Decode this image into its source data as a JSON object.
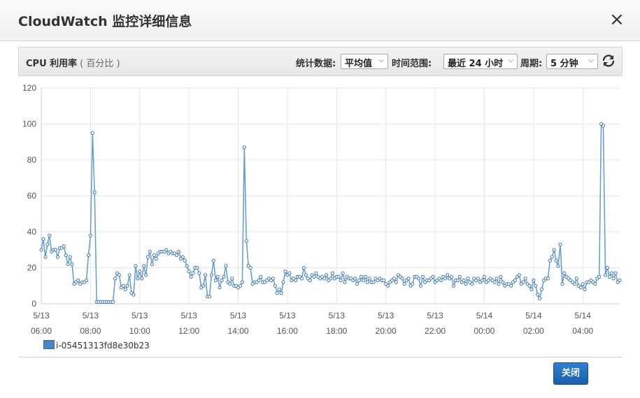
{
  "dialog": {
    "title": "CloudWatch 监控详细信息",
    "close_glyph": "×",
    "close_button": "关闭"
  },
  "toolbar": {
    "metric_name": "CPU 利用率",
    "metric_unit": "( 百分比 )",
    "stat_label": "统计数据:",
    "stat_value": "平均值",
    "range_label": "时间范围:",
    "range_value": "最近 24 小时",
    "period_label": "周期:",
    "period_value": "5 分钟",
    "refresh_icon": "refresh-icon"
  },
  "legend": {
    "label": "i-05451313fd8e30b23"
  },
  "colors": {
    "series": "#6a9fd4",
    "series_marker": "#3a78b8",
    "grid": "#e6e6e6"
  },
  "chart_data": {
    "type": "line",
    "title": "",
    "xlabel": "",
    "ylabel": "",
    "ylim": [
      0,
      120
    ],
    "yticks": [
      0,
      20,
      40,
      60,
      80,
      100,
      120
    ],
    "xtick_labels": [
      [
        "5/13",
        "06:00"
      ],
      [
        "5/13",
        "08:00"
      ],
      [
        "5/13",
        "10:00"
      ],
      [
        "5/13",
        "12:00"
      ],
      [
        "5/13",
        "14:00"
      ],
      [
        "5/13",
        "16:00"
      ],
      [
        "5/13",
        "18:00"
      ],
      [
        "5/13",
        "20:00"
      ],
      [
        "5/13",
        "22:00"
      ],
      [
        "5/14",
        "00:00"
      ],
      [
        "5/14",
        "02:00"
      ],
      [
        "5/14",
        "04:00"
      ]
    ],
    "xtick_hours": [
      6,
      8,
      10,
      12,
      14,
      16,
      18,
      20,
      22,
      24,
      26,
      28
    ],
    "x_start_hour": 6,
    "x_interval_minutes": 5,
    "grid": true,
    "series": [
      {
        "name": "i-05451313fd8e30b23",
        "values": [
          30,
          36,
          26,
          33,
          38,
          29,
          30,
          30,
          26,
          31,
          31,
          32,
          27,
          22,
          26,
          22,
          11,
          12,
          13,
          11,
          12,
          12,
          13,
          27,
          38,
          95,
          62,
          1,
          1,
          1,
          1,
          1,
          1,
          1,
          1,
          1,
          14,
          17,
          16,
          9,
          10,
          8,
          10,
          16,
          6,
          5,
          21,
          14,
          18,
          14,
          21,
          16,
          26,
          29,
          22,
          27,
          25,
          28,
          29,
          29,
          29,
          30,
          28,
          29,
          28,
          28,
          27,
          29,
          25,
          26,
          24,
          21,
          18,
          15,
          17,
          20,
          20,
          17,
          9,
          10,
          16,
          4,
          4,
          16,
          24,
          13,
          15,
          9,
          13,
          15,
          21,
          12,
          11,
          14,
          10,
          10,
          9,
          10,
          12,
          87,
          35,
          21,
          20,
          11,
          12,
          12,
          13,
          15,
          12,
          12,
          13,
          14,
          13,
          14,
          10,
          6,
          8,
          6,
          12,
          18,
          16,
          17,
          13,
          14,
          13,
          15,
          15,
          14,
          20,
          16,
          14,
          13,
          16,
          15,
          17,
          15,
          14,
          15,
          14,
          16,
          13,
          14,
          17,
          14,
          15,
          15,
          13,
          17,
          12,
          15,
          14,
          14,
          13,
          14,
          11,
          13,
          15,
          13,
          15,
          12,
          14,
          12,
          12,
          14,
          13,
          14,
          13,
          13,
          11,
          10,
          12,
          13,
          14,
          12,
          16,
          15,
          14,
          11,
          13,
          14,
          10,
          11,
          15,
          15,
          14,
          10,
          15,
          12,
          13,
          13,
          14,
          15,
          12,
          13,
          14,
          13,
          15,
          14,
          16,
          14,
          15,
          10,
          13,
          13,
          15,
          12,
          13,
          11,
          14,
          12,
          11,
          14,
          13,
          14,
          12,
          13,
          15,
          12,
          13,
          14,
          13,
          12,
          14,
          11,
          15,
          12,
          10,
          11,
          11,
          10,
          12,
          13,
          15,
          16,
          11,
          12,
          14,
          11,
          10,
          8,
          13,
          10,
          5,
          3,
          8,
          13,
          14,
          14,
          24,
          26,
          30,
          24,
          21,
          33,
          11,
          17,
          15,
          14,
          13,
          12,
          11,
          14,
          10,
          9,
          11,
          8,
          12,
          12,
          13,
          12,
          11,
          14,
          15,
          100,
          99,
          16,
          20,
          15,
          17,
          14,
          17,
          12,
          13
        ]
      }
    ]
  }
}
